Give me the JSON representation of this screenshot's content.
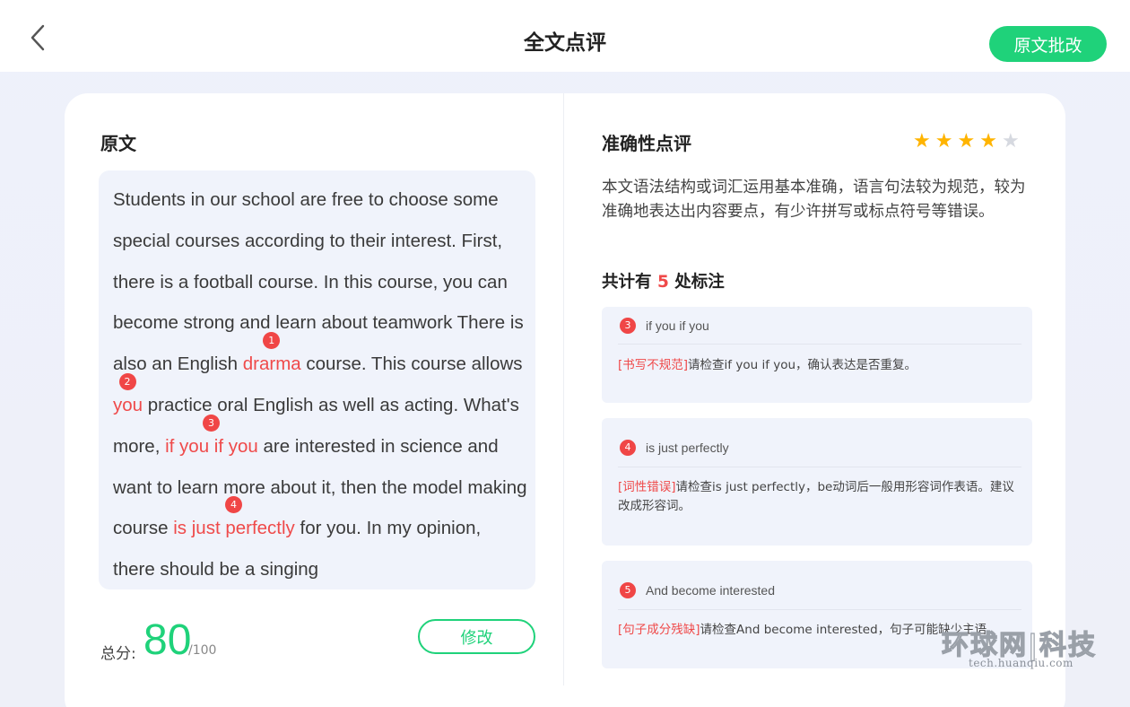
{
  "header": {
    "title": "全文点评",
    "review_button_label": "原文批改"
  },
  "left": {
    "title": "原文",
    "essay": {
      "p1": "Students in our school are free to choose some special courses according to their interest. First, there is a football course. In this course, you can become strong and learn about teamwork There is also an English ",
      "e1": "drarma",
      "p2": " course. This course allows ",
      "e2": "you",
      "p3": " practice oral English as well as acting. What's more, ",
      "e3": "if you if you",
      "p4": " are interested in science and want to learn more about it, then the model making course ",
      "e4": "is just perfectly",
      "p5": " for you. In my opinion, there should be a singing",
      "badges": [
        "1",
        "2",
        "3",
        "4"
      ]
    },
    "score": {
      "label": "总分:",
      "value": "80",
      "max": "/100"
    },
    "edit_button_label": "修改"
  },
  "right": {
    "title": "准确性点评",
    "rating": 4,
    "rating_max": 5,
    "comment": "本文语法结构或词汇运用基本准确，语言句法较为规范，较为准确地表达出内容要点，有少许拼写或标点符号等错误。",
    "count_prefix": "共计有 ",
    "count_value": "5",
    "count_suffix": " 处标注",
    "annotations": [
      {
        "num": "3",
        "phrase": "if you if you",
        "tag": "[书写不规范]",
        "text": "请检查if you if you，确认表达是否重复。"
      },
      {
        "num": "4",
        "phrase": "is just perfectly",
        "tag": "[词性错误]",
        "text": "请检查is just perfectly，be动词后一般用形容词作表语。建议改成形容词。"
      },
      {
        "num": "5",
        "phrase": "And become interested",
        "tag": "[句子成分残缺]",
        "text": "请检查And become interested，句子可能缺少主语。"
      }
    ]
  },
  "watermark": {
    "main": "环球网|科技",
    "sub": "tech.huanqiu.com"
  },
  "colors": {
    "accent_green": "#1fd27a",
    "error_red": "#ef4a4a",
    "star_on": "#ffb400",
    "star_off": "#d6d9e0"
  }
}
